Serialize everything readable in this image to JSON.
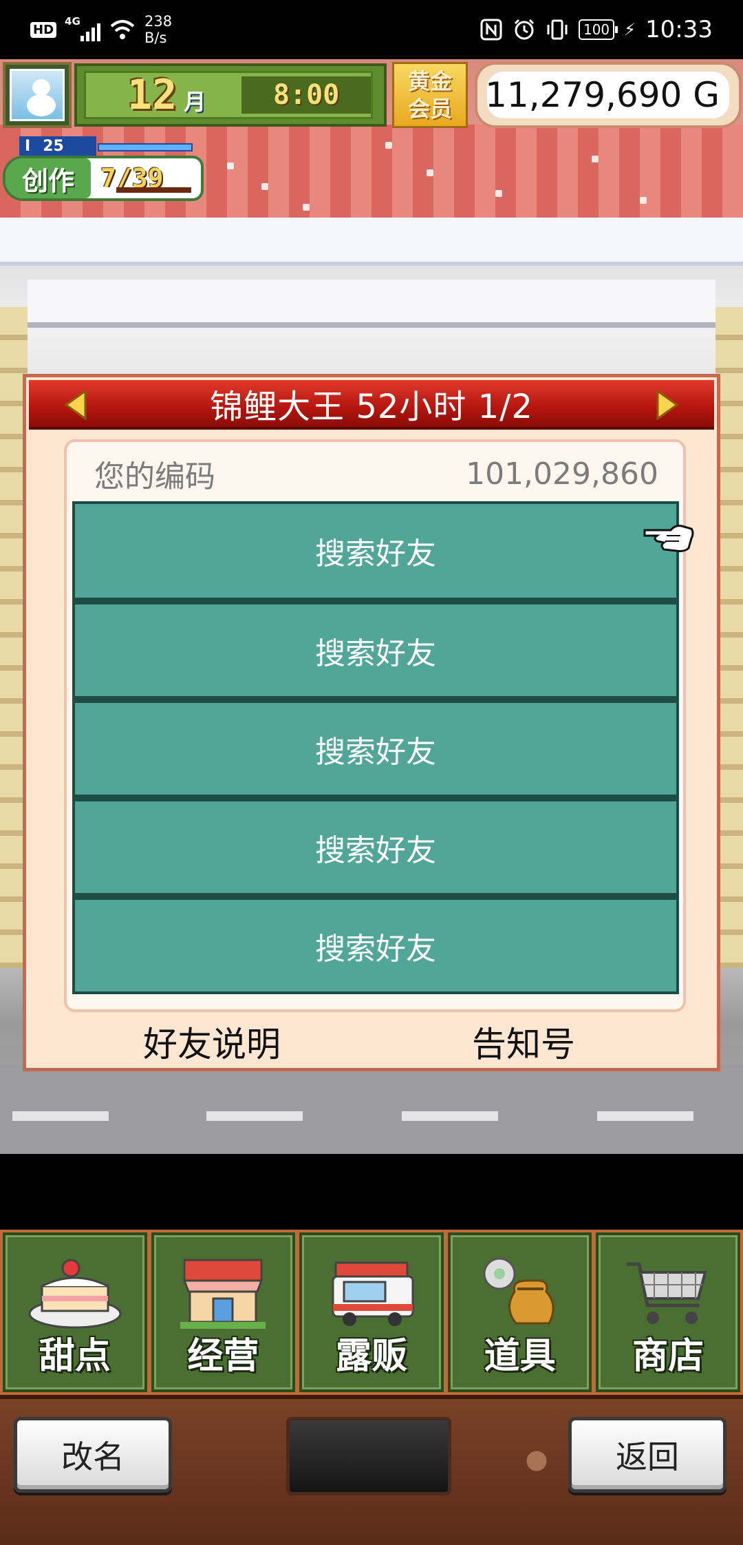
{
  "status_bar": {
    "hd": "HD",
    "network": "4G",
    "net_speed_value": "238",
    "net_speed_unit": "B/s",
    "icons": [
      "nfc-icon",
      "alarm-icon",
      "vibrate-icon"
    ],
    "battery": "100",
    "time": "10:33"
  },
  "hud": {
    "month": "12",
    "month_unit": "月",
    "clock": "8:00",
    "gold_member": "黄金会员",
    "money": "11,279,690 G",
    "create_level_prefix": "I",
    "create_level": "25",
    "create_label": "创作",
    "create_count": "7/39"
  },
  "dialog": {
    "title": "锦鲤大王  52小时 1/2",
    "code_label": "您的编码",
    "code_value": "101,029,860",
    "friend_slots": [
      "搜索好友",
      "搜索好友",
      "搜索好友",
      "搜索好友",
      "搜索好友"
    ],
    "footer_left": "好友说明",
    "footer_right": "告知号"
  },
  "menu": {
    "items": [
      {
        "label": "甜点",
        "icon": "cake-icon"
      },
      {
        "label": "经营",
        "icon": "shop-icon"
      },
      {
        "label": "露贩",
        "icon": "food-truck-icon"
      },
      {
        "label": "道具",
        "icon": "item-bag-icon"
      },
      {
        "label": "商店",
        "icon": "cart-icon"
      }
    ]
  },
  "bottom": {
    "rename": "改名",
    "back": "返回"
  }
}
